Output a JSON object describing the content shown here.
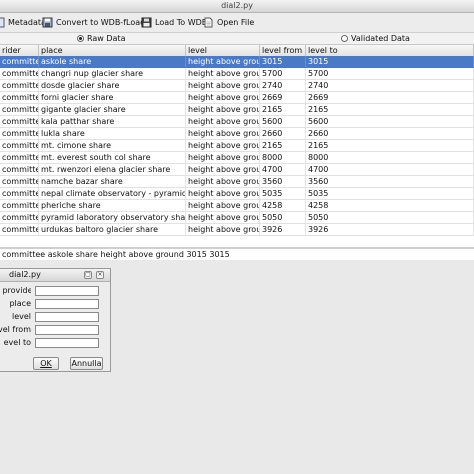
{
  "window": {
    "title": "dial2.py"
  },
  "toolbar": {
    "metadata_label": "Metadata",
    "convert_label": "Convert to WDB-fLoad",
    "load_label": "Load To WDB",
    "open_label": "Open File"
  },
  "mode": {
    "raw_label": "Raw Data",
    "validated_label": "Validated Data",
    "selected": "raw"
  },
  "table": {
    "columns": [
      "rider",
      "place",
      "level",
      "level from",
      "level to"
    ],
    "rows": [
      [
        "committee",
        "askole share",
        "height above ground",
        "3015",
        "3015"
      ],
      [
        "committee",
        "changri nup glacier share",
        "height above ground",
        "5700",
        "5700"
      ],
      [
        "committee",
        "dosde glacier share",
        "height above ground",
        "2740",
        "2740"
      ],
      [
        "committee",
        "forni glacier share",
        "height above ground",
        "2669",
        "2669"
      ],
      [
        "committee",
        "gigante glacier share",
        "height above ground",
        "2165",
        "2165"
      ],
      [
        "committee",
        "kala patthar share",
        "height above ground",
        "5600",
        "5600"
      ],
      [
        "committee",
        "lukla share",
        "height above ground",
        "2660",
        "2660"
      ],
      [
        "committee",
        "mt. cimone share",
        "height above ground",
        "2165",
        "2165"
      ],
      [
        "committee",
        "mt. everest south col share",
        "height above ground",
        "8000",
        "8000"
      ],
      [
        "committee",
        "mt. rwenzori elena glacier share",
        "height above ground",
        "4700",
        "4700"
      ],
      [
        "committee",
        "namche bazar share",
        "height above ground",
        "3560",
        "3560"
      ],
      [
        "committee",
        "nepal climate observatory - pyramid share",
        "height above ground",
        "5035",
        "5035"
      ],
      [
        "committee",
        "pheriche share",
        "height above ground",
        "4258",
        "4258"
      ],
      [
        "committee",
        "pyramid laboratory observatory share",
        "height above ground",
        "5050",
        "5050"
      ],
      [
        "committee",
        "urdukas baltoro glacier share",
        "height above ground",
        "3926",
        "3926"
      ]
    ],
    "selected_row": 0
  },
  "status": {
    "text": "committee askole share height above ground 3015 3015"
  },
  "dialog": {
    "title": "dial2.py",
    "fields": [
      {
        "label": "a provider",
        "value": ""
      },
      {
        "label": "place",
        "value": ""
      },
      {
        "label": "level",
        "value": ""
      },
      {
        "label": "vel from",
        "value": ""
      },
      {
        "label": "evel to",
        "value": ""
      }
    ],
    "ok_label": "OK",
    "cancel_label": "Annulla"
  },
  "colors": {
    "selection": "#4a79c6",
    "background": "#e9e9e9"
  }
}
